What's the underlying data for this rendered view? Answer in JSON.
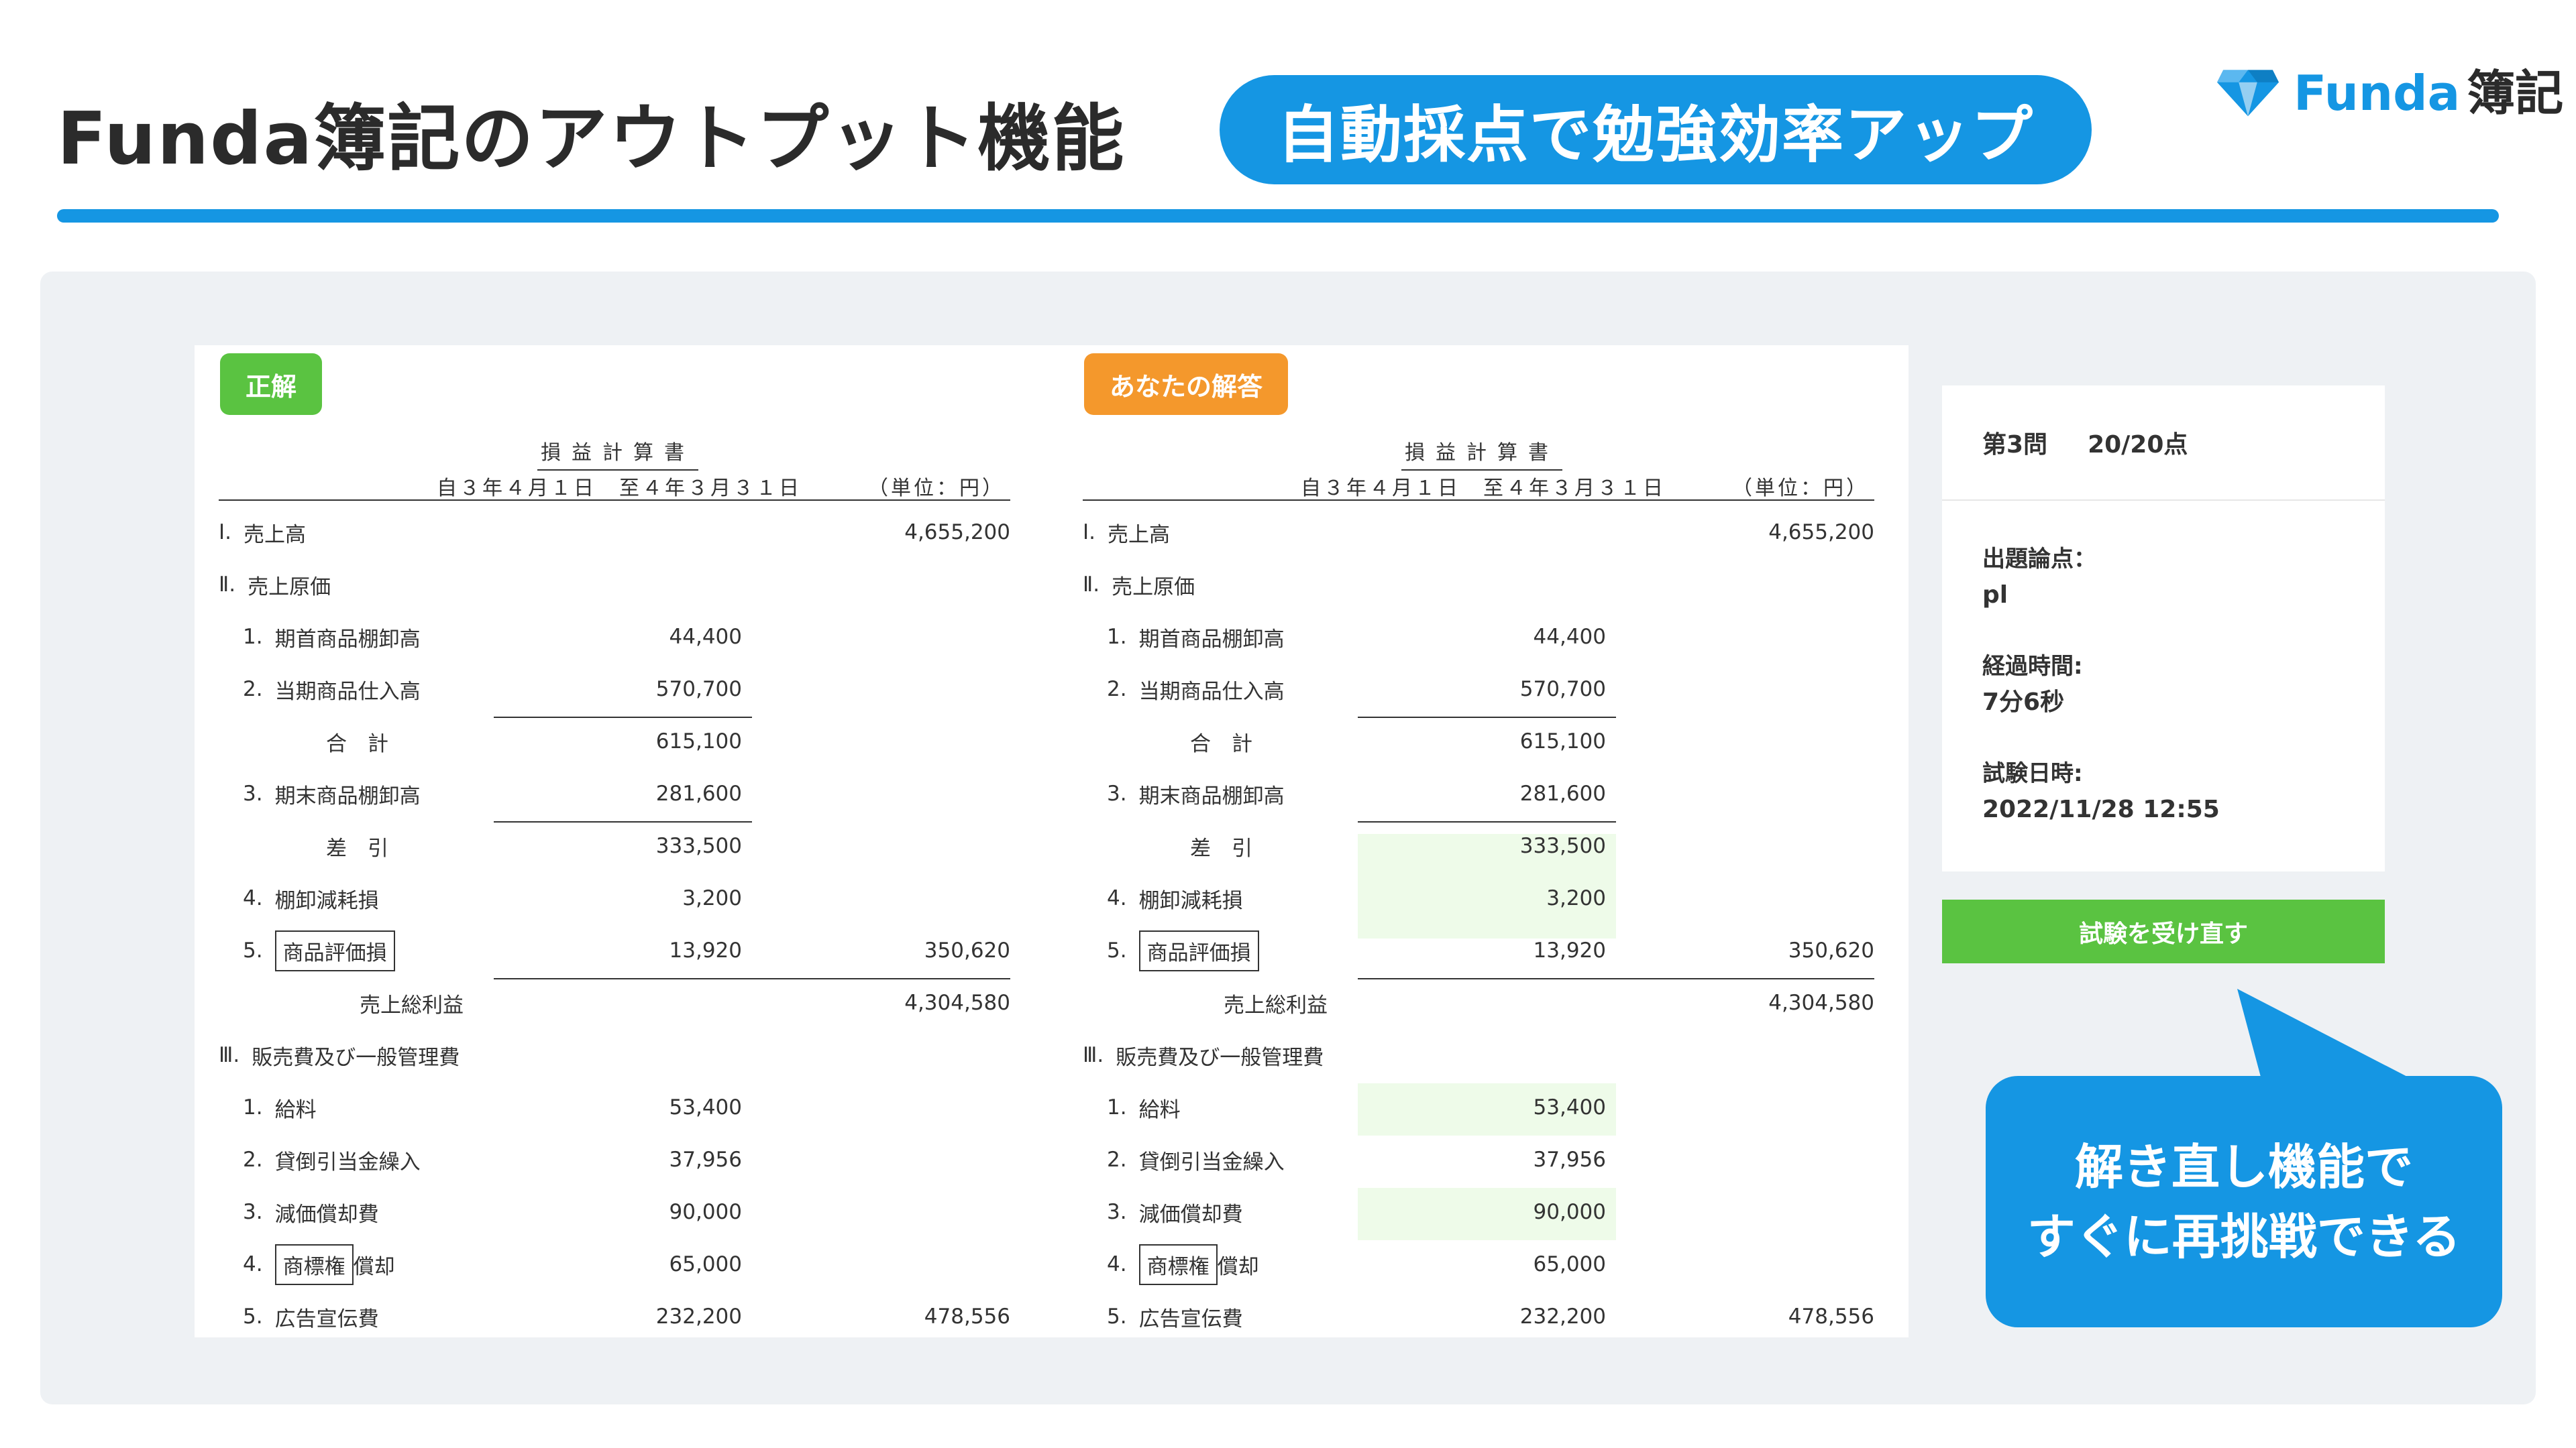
{
  "header": {
    "title": "Funda簿記のアウトプット機能",
    "banner": "自動採点で勉強効率アップ",
    "logo_text": "Funda",
    "logo_kanji": "簿記"
  },
  "colors": {
    "brand_blue": "#1596e3",
    "correct_green": "#5ac341",
    "answer_orange": "#f4982c",
    "highlight_green": "#eefbe9",
    "content_bg": "#eef1f4"
  },
  "statement": {
    "title": "損益計算書",
    "period": "自３年４月１日　至４年３月３１日",
    "unit": "（単位：円）"
  },
  "panels": {
    "correct": {
      "badge": "正解",
      "rows": [
        {
          "num": "Ⅰ.",
          "label": "売上高",
          "mid": "",
          "right": "4,655,200"
        },
        {
          "num": "Ⅱ.",
          "label": "売上原価",
          "mid": "",
          "right": ""
        },
        {
          "num": "1.",
          "label": "期首商品棚卸高",
          "mid": "44,400",
          "right": ""
        },
        {
          "num": "2.",
          "label": "当期商品仕入高",
          "mid": "570,700",
          "right": ""
        },
        {
          "num": "",
          "label": "合　計",
          "mid": "615,100",
          "right": ""
        },
        {
          "num": "3.",
          "label": "期末商品棚卸高",
          "mid": "281,600",
          "right": ""
        },
        {
          "num": "",
          "label": "差　引",
          "mid": "333,500",
          "right": ""
        },
        {
          "num": "4.",
          "label": "棚卸減耗損",
          "mid": "3,200",
          "right": ""
        },
        {
          "num": "5.",
          "label": "商品評価損",
          "mid": "13,920",
          "right": "350,620"
        },
        {
          "num": "",
          "label": "売上総利益",
          "mid": "",
          "right": "4,304,580"
        },
        {
          "num": "Ⅲ.",
          "label": "販売費及び一般管理費",
          "mid": "",
          "right": ""
        },
        {
          "num": "1.",
          "label": "給料",
          "mid": "53,400",
          "right": ""
        },
        {
          "num": "2.",
          "label": "貸倒引当金繰入",
          "mid": "37,956",
          "right": ""
        },
        {
          "num": "3.",
          "label": "減価償却費",
          "mid": "90,000",
          "right": ""
        },
        {
          "num": "4.",
          "label_boxed": "商標権",
          "label_rest": "償却",
          "mid": "65,000",
          "right": ""
        },
        {
          "num": "5.",
          "label": "広告宣伝費",
          "mid": "232,200",
          "right": "478,556"
        }
      ]
    },
    "yours": {
      "badge": "あなたの解答",
      "rows": [
        {
          "num": "Ⅰ.",
          "label": "売上高",
          "mid": "",
          "right": "4,655,200"
        },
        {
          "num": "Ⅱ.",
          "label": "売上原価",
          "mid": "",
          "right": ""
        },
        {
          "num": "1.",
          "label": "期首商品棚卸高",
          "mid": "44,400",
          "right": ""
        },
        {
          "num": "2.",
          "label": "当期商品仕入高",
          "mid": "570,700",
          "right": ""
        },
        {
          "num": "",
          "label": "合　計",
          "mid": "615,100",
          "right": ""
        },
        {
          "num": "3.",
          "label": "期末商品棚卸高",
          "mid": "281,600",
          "right": ""
        },
        {
          "num": "",
          "label": "差　引",
          "mid": "333,500",
          "right": ""
        },
        {
          "num": "4.",
          "label": "棚卸減耗損",
          "mid": "3,200",
          "right": ""
        },
        {
          "num": "5.",
          "label": "商品評価損",
          "mid": "13,920",
          "right": "350,620"
        },
        {
          "num": "",
          "label": "売上総利益",
          "mid": "",
          "right": "4,304,580"
        },
        {
          "num": "Ⅲ.",
          "label": "販売費及び一般管理費",
          "mid": "",
          "right": ""
        },
        {
          "num": "1.",
          "label": "給料",
          "mid": "53,400",
          "right": ""
        },
        {
          "num": "2.",
          "label": "貸倒引当金繰入",
          "mid": "37,956",
          "right": ""
        },
        {
          "num": "3.",
          "label": "減価償却費",
          "mid": "90,000",
          "right": ""
        },
        {
          "num": "4.",
          "label_boxed": "商標権",
          "label_rest": "償却",
          "mid": "65,000",
          "right": ""
        },
        {
          "num": "5.",
          "label": "広告宣伝費",
          "mid": "232,200",
          "right": "478,556"
        }
      ]
    }
  },
  "result": {
    "question": "第3問",
    "score": "20/20点",
    "topic_label": "出題論点：",
    "topic_value": "pl",
    "elapsed_label": "経過時間:",
    "elapsed_value": "7分6秒",
    "date_label": "試験日時:",
    "date_value": "2022/11/28 12:55",
    "retake_label": "試験を受け直す"
  },
  "callout": {
    "line1": "解き直し機能で",
    "line2": "すぐに再挑戦できる"
  }
}
